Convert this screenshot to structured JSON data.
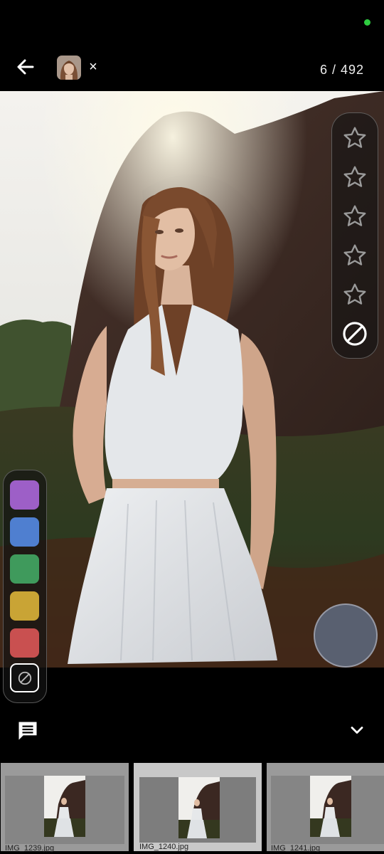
{
  "header": {
    "counter": "6 / 492",
    "close_glyph": "×"
  },
  "icons": {
    "back": "arrow-left-icon",
    "star": "star-outline-icon",
    "reject": "reject-circle-slash-icon",
    "comment": "comment-icon",
    "expand": "chevron-down-icon"
  },
  "rating": {
    "stars_filled": 0,
    "stars_total": 5
  },
  "color_labels": [
    {
      "name": "purple",
      "color": "#9d5fc7"
    },
    {
      "name": "blue",
      "color": "#4f7fd0"
    },
    {
      "name": "green",
      "color": "#3f9a5c"
    },
    {
      "name": "yellow",
      "color": "#c9a435"
    },
    {
      "name": "red",
      "color": "#c95050"
    }
  ],
  "fab": {
    "color": "#596070"
  },
  "filmstrip": [
    {
      "label": "IMG_1239.jpg",
      "selected": false
    },
    {
      "label": "IMG_1240.jpg",
      "selected": true
    },
    {
      "label": "IMG_1241.jpg",
      "selected": false
    }
  ]
}
